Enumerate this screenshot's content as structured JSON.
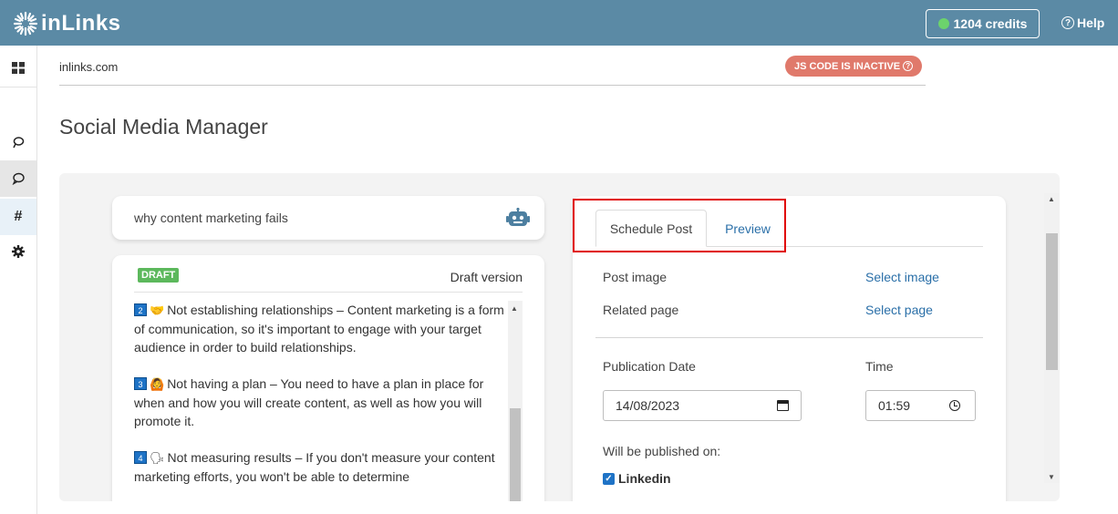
{
  "header": {
    "logo_text": "inLinks",
    "credits_label": "1204 credits",
    "help_label": "Help"
  },
  "sidebar": {
    "items": [
      {
        "name": "dashboard",
        "icon": "grid-icon"
      },
      {
        "name": "topics",
        "icon": "lasso-icon"
      },
      {
        "name": "social",
        "icon": "chat-bubble-icon"
      },
      {
        "name": "hashtags",
        "icon": "hash-icon",
        "glyph": "#"
      },
      {
        "name": "settings",
        "icon": "gear-icon"
      }
    ]
  },
  "site": {
    "domain": "inlinks.com",
    "js_status": "JS CODE IS INACTIVE"
  },
  "page": {
    "title": "Social Media Manager"
  },
  "topic": {
    "text": "why content marketing fails"
  },
  "draft": {
    "badge": "DRAFT",
    "version_label": "Draft version",
    "items": [
      {
        "num": "2",
        "emoji": "🤝",
        "text": "Not establishing relationships – Content marketing is a form of communication, so it's important to engage with your target audience in order to build relationships."
      },
      {
        "num": "3",
        "emoji": "🙆",
        "text": "Not having a plan – You need to have a plan in place for when and how you will create content, as well as how you will promote it."
      },
      {
        "num": "4",
        "emoji": "🗣",
        "text": "Not measuring results – If you don't measure your content marketing efforts, you won't be able to determine"
      }
    ]
  },
  "schedule": {
    "tabs": [
      {
        "label": "Schedule Post",
        "active": true
      },
      {
        "label": "Preview",
        "active": false
      }
    ],
    "post_image_label": "Post image",
    "select_image_link": "Select image",
    "related_page_label": "Related page",
    "select_page_link": "Select page",
    "publication_date_label": "Publication Date",
    "publication_date_value": "14/08/2023",
    "time_label": "Time",
    "time_value": "01:59",
    "published_on_label": "Will be published on:",
    "platform_label": "Linkedin",
    "platform_checked": true
  },
  "colors": {
    "topbar": "#5b8aa5",
    "js_badge": "#e0796b",
    "link": "#2a6fa8",
    "draft_badge": "#5cb85c",
    "highlight": "#e00000"
  }
}
